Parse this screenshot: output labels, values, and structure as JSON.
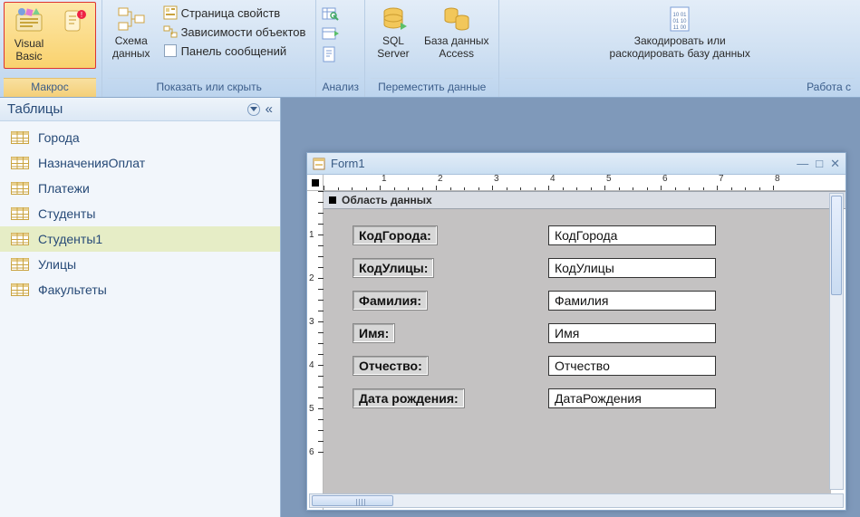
{
  "ribbon": {
    "groups": {
      "macro": {
        "vb": "Visual\nBasic",
        "label": "Макрос"
      },
      "schema": {
        "btn": "Схема\nданных",
        "prop_page": "Страница свойств",
        "dependencies": "Зависимости объектов",
        "msg_panel": "Панель сообщений",
        "label": "Показать или скрыть"
      },
      "analyze": {
        "label": "Анализ"
      },
      "move": {
        "sql": "SQL\nServer",
        "access_db": "База данных\nAccess",
        "label": "Переместить данные"
      },
      "dbwork": {
        "encode": "Закодировать или\nраскодировать базу данных",
        "label": "Работа с"
      }
    }
  },
  "nav": {
    "header": "Таблицы",
    "items": [
      "Города",
      "НазначенияОплат",
      "Платежи",
      "Студенты",
      "Студенты1",
      "Улицы",
      "Факультеты"
    ],
    "selected_index": 4
  },
  "form_window": {
    "title": "Form1",
    "section_header": "Область данных",
    "rows": [
      {
        "label": "КодГорода:",
        "field": "КодГорода"
      },
      {
        "label": "КодУлицы:",
        "field": "КодУлицы"
      },
      {
        "label": "Фамилия:",
        "field": "Фамилия"
      },
      {
        "label": "Имя:",
        "field": "Имя"
      },
      {
        "label": "Отчество:",
        "field": "Отчество"
      },
      {
        "label": "Дата рождения:",
        "field": "ДатаРождения"
      }
    ],
    "h_ruler_max": 8,
    "v_ruler_max": 6
  }
}
